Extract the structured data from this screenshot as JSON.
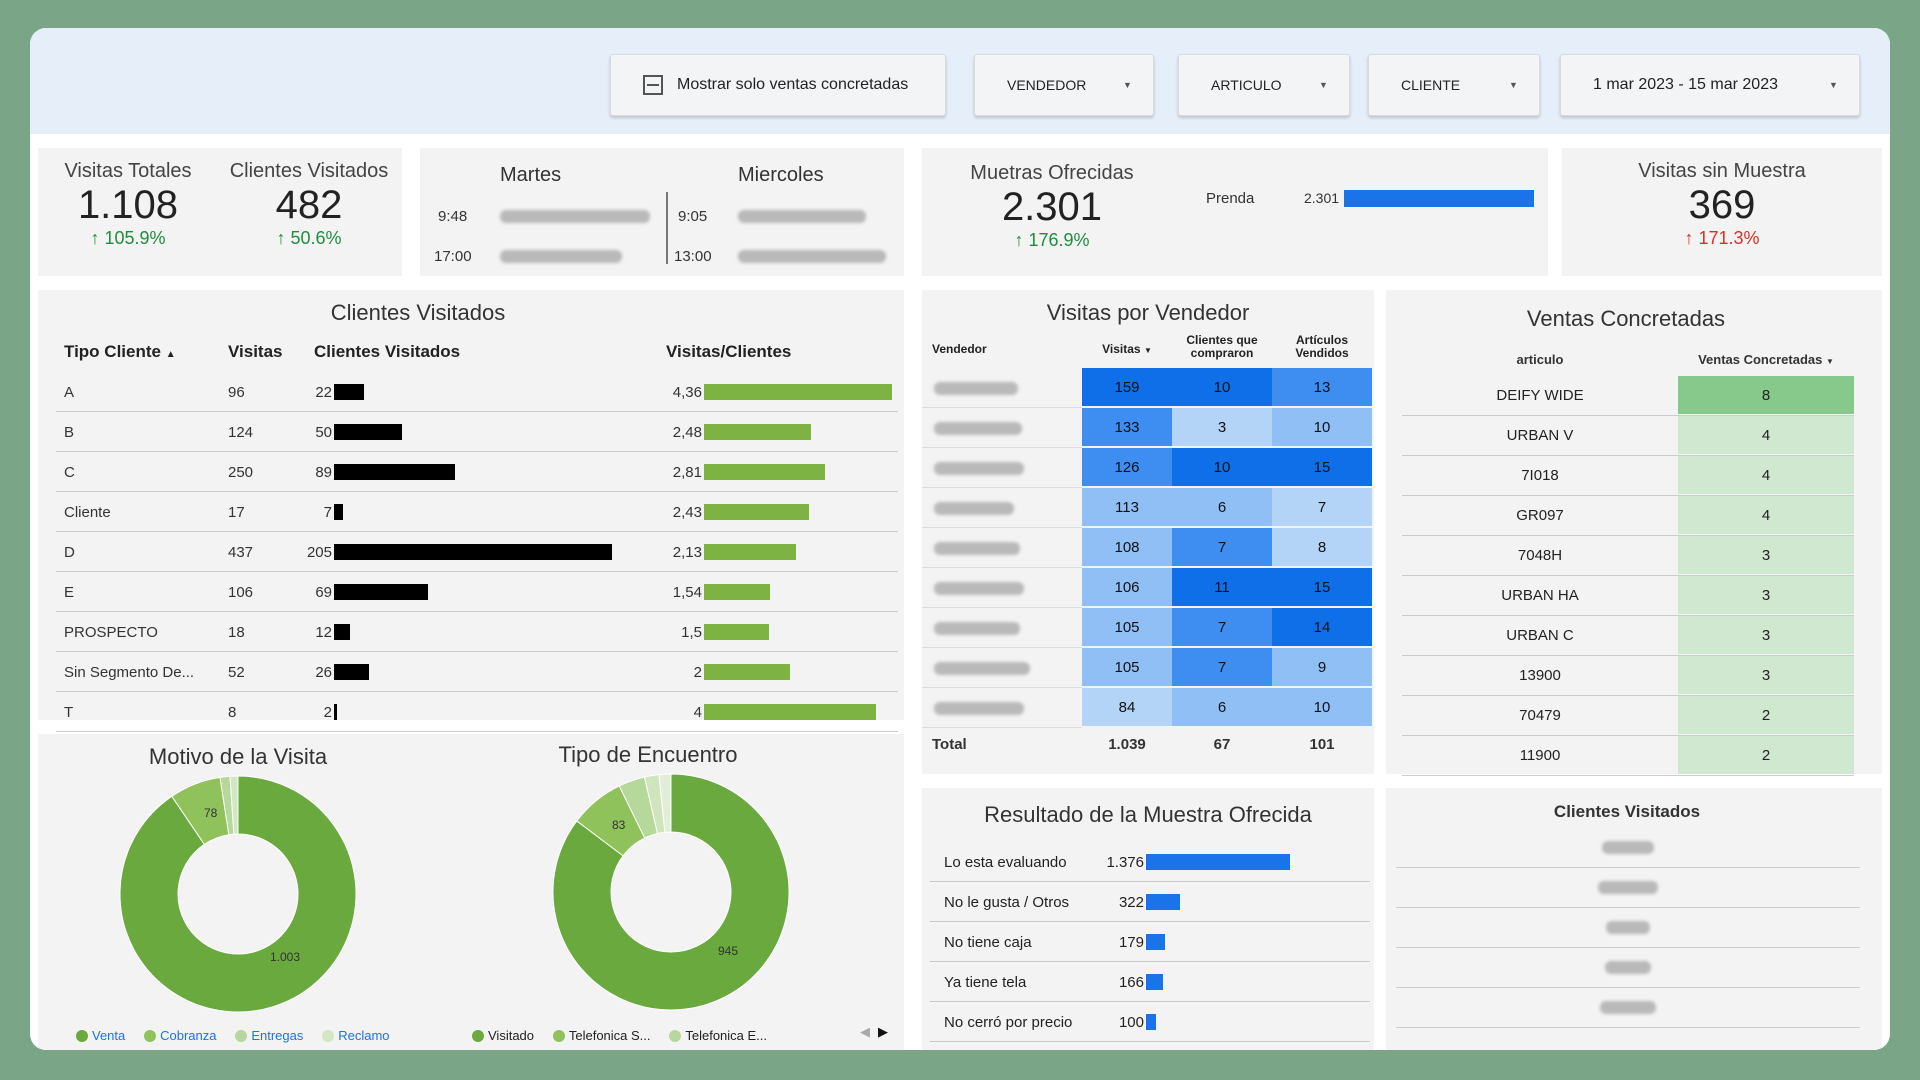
{
  "filters": {
    "only_sales_label": "Mostrar solo ventas concretadas",
    "vendedor": "VENDEDOR",
    "articulo": "ARTICULO",
    "cliente": "CLIENTE",
    "date_range": "1 mar 2023 - 15 mar 2023"
  },
  "kpi": {
    "visitas_totales": {
      "title": "Visitas Totales",
      "value": "1.108",
      "change": "105.9%"
    },
    "clientes_visitados": {
      "title": "Clientes Visitados",
      "value": "482",
      "change": "50.6%"
    },
    "muestras": {
      "title": "Muetras Ofrecidas",
      "value": "2.301",
      "change": "176.9%",
      "prenda_label": "Prenda",
      "prenda_value": "2.301",
      "prenda_fill": 1.0
    },
    "visitas_sin_muestra": {
      "title": "Visitas sin Muestra",
      "value": "369",
      "change": "171.3%"
    }
  },
  "schedule": {
    "martes": {
      "title": "Martes",
      "times": [
        "9:48",
        "17:00"
      ]
    },
    "miercoles": {
      "title": "Miercoles",
      "times": [
        "9:05",
        "13:00"
      ]
    }
  },
  "clientes_table": {
    "title": "Clientes Visitados",
    "headers": {
      "tipo": "Tipo Cliente",
      "visitas": "Visitas",
      "clientes": "Clientes Visitados",
      "ratio": "Visitas/Clientes"
    },
    "rows": [
      {
        "tipo": "A",
        "visitas": "96",
        "clientes": "22",
        "ratio": "4,36",
        "c": 22,
        "r": 4.36
      },
      {
        "tipo": "B",
        "visitas": "124",
        "clientes": "50",
        "ratio": "2,48",
        "c": 50,
        "r": 2.48
      },
      {
        "tipo": "C",
        "visitas": "250",
        "clientes": "89",
        "ratio": "2,81",
        "c": 89,
        "r": 2.81
      },
      {
        "tipo": "Cliente",
        "visitas": "17",
        "clientes": "7",
        "ratio": "2,43",
        "c": 7,
        "r": 2.43
      },
      {
        "tipo": "D",
        "visitas": "437",
        "clientes": "205",
        "ratio": "2,13",
        "c": 205,
        "r": 2.13
      },
      {
        "tipo": "E",
        "visitas": "106",
        "clientes": "69",
        "ratio": "1,54",
        "c": 69,
        "r": 1.54
      },
      {
        "tipo": "PROSPECTO",
        "visitas": "18",
        "clientes": "12",
        "ratio": "1,5",
        "c": 12,
        "r": 1.5
      },
      {
        "tipo": "Sin Segmento De...",
        "visitas": "52",
        "clientes": "26",
        "ratio": "2",
        "c": 26,
        "r": 2
      },
      {
        "tipo": "T",
        "visitas": "8",
        "clientes": "2",
        "ratio": "4",
        "c": 2,
        "r": 4
      }
    ]
  },
  "vendedor_table": {
    "title": "Visitas por Vendedor",
    "headers": {
      "vendedor": "Vendedor",
      "visitas": "Visitas",
      "clientes": "Clientes que compraron",
      "articulos": "Artículos Vendidos"
    },
    "rows": [
      {
        "visitas": "159",
        "clientes": "10",
        "articulos": "13"
      },
      {
        "visitas": "133",
        "clientes": "3",
        "articulos": "10"
      },
      {
        "visitas": "126",
        "clientes": "10",
        "articulos": "15"
      },
      {
        "visitas": "113",
        "clientes": "6",
        "articulos": "7"
      },
      {
        "visitas": "108",
        "clientes": "7",
        "articulos": "8"
      },
      {
        "visitas": "106",
        "clientes": "11",
        "articulos": "15"
      },
      {
        "visitas": "105",
        "clientes": "7",
        "articulos": "14"
      },
      {
        "visitas": "105",
        "clientes": "7",
        "articulos": "9"
      },
      {
        "visitas": "84",
        "clientes": "6",
        "articulos": "10"
      }
    ],
    "total": {
      "label": "Total",
      "visitas": "1.039",
      "clientes": "67",
      "articulos": "101"
    }
  },
  "ventas_table": {
    "title": "Ventas Concretadas",
    "headers": {
      "articulo": "articulo",
      "ventas": "Ventas Concretadas"
    },
    "rows": [
      {
        "articulo": "DEIFY WIDE",
        "ventas": "8"
      },
      {
        "articulo": "URBAN V",
        "ventas": "4"
      },
      {
        "articulo": "7I018",
        "ventas": "4"
      },
      {
        "articulo": "GR097",
        "ventas": "4"
      },
      {
        "articulo": "7048H",
        "ventas": "3"
      },
      {
        "articulo": "URBAN HA",
        "ventas": "3"
      },
      {
        "articulo": "URBAN C",
        "ventas": "3"
      },
      {
        "articulo": "13900",
        "ventas": "3"
      },
      {
        "articulo": "70479",
        "ventas": "2"
      },
      {
        "articulo": "11900",
        "ventas": "2"
      }
    ]
  },
  "motivo": {
    "title": "Motivo de la Visita",
    "big_label": "1.003",
    "small_label": "78",
    "legend": [
      "Venta",
      "Cobranza",
      "Entregas",
      "Reclamo"
    ],
    "chart_data": {
      "type": "pie",
      "categories": [
        "Venta",
        "Cobranza",
        "Entregas",
        "Reclamo"
      ],
      "values": [
        1003,
        78,
        15,
        12
      ]
    }
  },
  "encuentro": {
    "title": "Tipo de Encuentro",
    "big_label": "945",
    "small_label": "83",
    "legend": [
      "Visitado",
      "Telefonica S...",
      "Telefonica E..."
    ],
    "chart_data": {
      "type": "pie",
      "categories": [
        "Visitado",
        "Telefonica S...",
        "Telefonica E..."
      ],
      "values": [
        945,
        83,
        40,
        22,
        18
      ]
    }
  },
  "resultado": {
    "title": "Resultado de la Muestra Ofrecida",
    "rows": [
      {
        "label": "Lo esta evaluando",
        "value": "1.376",
        "n": 1376
      },
      {
        "label": "No le gusta / Otros",
        "value": "322",
        "n": 322
      },
      {
        "label": "No tiene caja",
        "value": "179",
        "n": 179
      },
      {
        "label": "Ya tiene tela",
        "value": "166",
        "n": 166
      },
      {
        "label": "No cerró por precio",
        "value": "100",
        "n": 100
      }
    ]
  },
  "clientes_list": {
    "title": "Clientes Visitados"
  },
  "colors": {
    "accent_blue": "#1a73e8",
    "green": "#7cb342",
    "green_table": "#81c784",
    "up": "#1e8e3e",
    "down": "#d93025"
  }
}
